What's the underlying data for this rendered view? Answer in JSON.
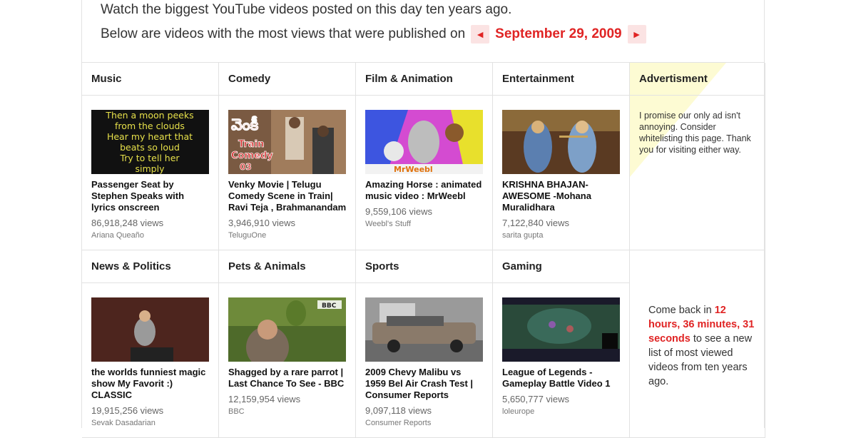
{
  "intro": {
    "line1": "Watch the biggest YouTube videos posted on this day ten years ago.",
    "line2": "Below are videos with the most views that were published on",
    "date": "September 29, 2009",
    "prev_icon": "◄",
    "next_icon": "►"
  },
  "categories": [
    {
      "name": "Music",
      "video": {
        "title": "Passenger Seat by Stephen Speaks with lyrics onscreen",
        "views": "86,918,248 views",
        "channel": "Ariana Queaño",
        "thumb_text": [
          "Then a moon peeks",
          "from the clouds",
          "Hear my heart that",
          "beats so loud",
          "Try to tell her",
          "simply"
        ]
      }
    },
    {
      "name": "Comedy",
      "video": {
        "title": "Venky Movie | Telugu Comedy Scene in Train| Ravi Teja , Brahmanandam",
        "views": "3,946,910 views",
        "channel": "TeluguOne",
        "thumb_text": [
          "వెంకీ",
          "Train",
          "Comedy",
          "03"
        ]
      }
    },
    {
      "name": "Film & Animation",
      "video": {
        "title": "Amazing Horse : animated music video : MrWeebl",
        "views": "9,559,106 views",
        "channel": "Weebl's Stuff",
        "thumb_text": [
          "MrWeebl"
        ]
      }
    },
    {
      "name": "Entertainment",
      "video": {
        "title": "KRISHNA BHAJAN- AWESOME -Mohana Muralidhara",
        "views": "7,122,840 views",
        "channel": "sarita gupta"
      }
    },
    {
      "name": "News & Politics",
      "video": {
        "title": "the worlds funniest magic show My Favorit :) CLASSIC",
        "views": "19,915,256 views",
        "channel": "Sevak Dasadarian"
      }
    },
    {
      "name": "Pets & Animals",
      "video": {
        "title": "Shagged by a rare parrot | Last Chance To See - BBC",
        "views": "12,159,954 views",
        "channel": "BBC",
        "thumb_text": [
          "BBC"
        ]
      }
    },
    {
      "name": "Sports",
      "video": {
        "title": "2009 Chevy Malibu vs 1959 Bel Air Crash Test | Consumer Reports",
        "views": "9,097,118 views",
        "channel": "Consumer Reports"
      }
    },
    {
      "name": "Gaming",
      "video": {
        "title": "League of Legends - Gameplay Battle Video 1",
        "views": "5,650,777 views",
        "channel": "loleurope"
      }
    }
  ],
  "ad": {
    "heading": "Advertisment",
    "text": "I promise our only ad isn't annoying. Consider whitelisting this page. Thank you for visiting either way."
  },
  "countdown": {
    "prefix": "Come back in",
    "hours": "12 hours,",
    "minutes": "36 minutes,",
    "seconds": "31 seconds",
    "suffix": "to see a new list of most viewed videos from ten years ago."
  }
}
